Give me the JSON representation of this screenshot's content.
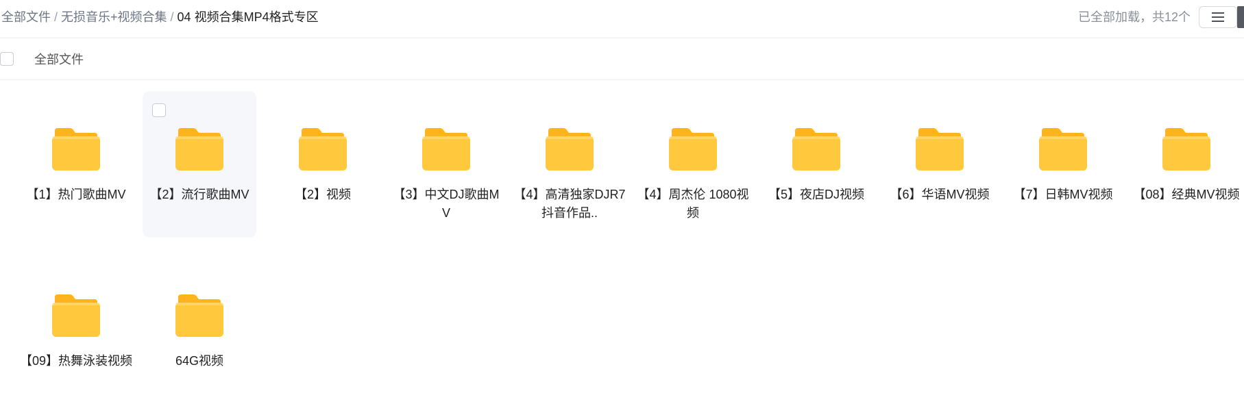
{
  "breadcrumb": {
    "items": [
      "全部文件",
      "无损音乐+视频合集"
    ],
    "separator": "/",
    "current": "04 视频合集MP4格式专区"
  },
  "status": {
    "loaded_text": "已全部加载，共12个"
  },
  "toolbar": {
    "view_toggle_icon": "list-view-icon"
  },
  "selectbar": {
    "label": "全部文件"
  },
  "folders": [
    {
      "name": "【1】热门歌曲MV"
    },
    {
      "name": "【2】流行歌曲MV",
      "hovered": true
    },
    {
      "name": "【2】视频"
    },
    {
      "name": "【3】中文DJ歌曲MV"
    },
    {
      "name": "【4】高清独家DJR7抖音作品.."
    },
    {
      "name": "【4】周杰伦 1080视频"
    },
    {
      "name": "【5】夜店DJ视频"
    },
    {
      "name": "【6】华语MV视频"
    },
    {
      "name": "【7】日韩MV视频"
    },
    {
      "name": "【08】经典MV视频"
    },
    {
      "name": "【09】热舞泳装视频"
    },
    {
      "name": "64G视频"
    }
  ],
  "colors": {
    "folder_body": "#FFC83D",
    "folder_back": "#FFB41E",
    "hover_bg": "#F6F7FA",
    "muted_text": "#8A8F99"
  }
}
